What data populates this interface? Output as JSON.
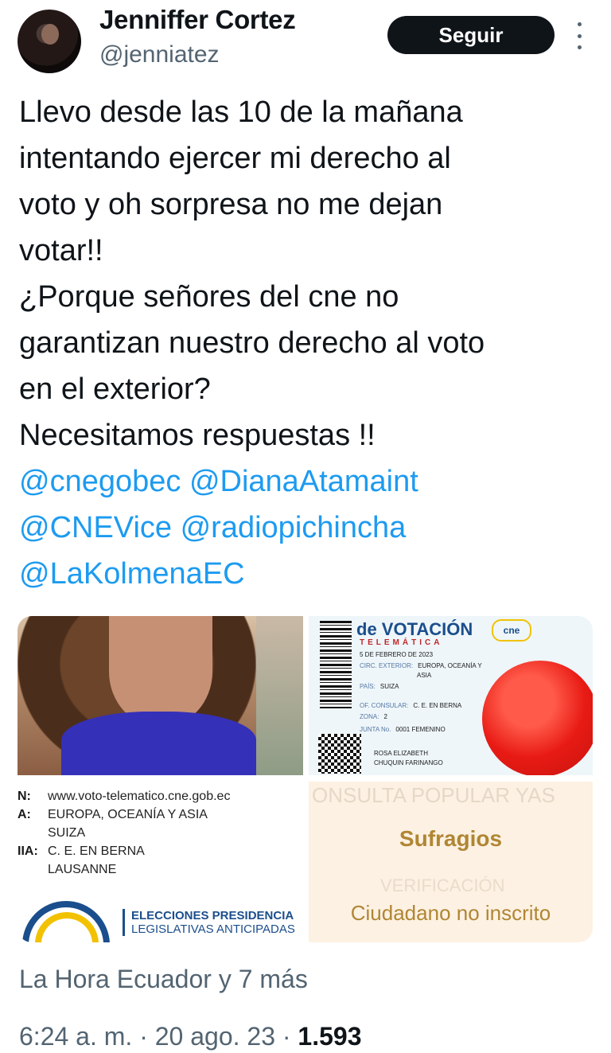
{
  "author": {
    "name": "Jenniffer Cortez",
    "handle": "@jenniatez",
    "follow_label": "Seguir"
  },
  "tweet": {
    "lines": [
      "Llevo desde las 10 de la mañana",
      "intentando ejercer mi derecho al",
      "voto y oh sorpresa no me dejan",
      "votar!!",
      "¿Porque señores del cne no",
      "garantizan nuestro derecho al voto",
      "en el exterior?",
      "Necesitamos respuestas !!"
    ],
    "mentions": [
      "@cnegobec",
      "@DianaAtamaint",
      "@CNEVice",
      "@radiopichincha",
      "@LaKolmenaEC"
    ]
  },
  "media": {
    "certificate": {
      "title": "de VOTACIÓN",
      "subtitle": "TELEMÁTICA",
      "date": "5 DE FEBRERO DE 2023",
      "circ_label": "CIRC. EXTERIOR:",
      "circ_value": "EUROPA, OCEANÍA Y",
      "circ_value2": "ASIA",
      "pais_label": "PAÍS:",
      "pais_value": "SUIZA",
      "consular_label": "OF. CONSULAR:",
      "consular_value": "C. E. EN BERNA",
      "zona_label": "ZONA:",
      "zona_value": "2",
      "junta_label": "JUNTA No.",
      "junta_value": "0001 FEMENINO",
      "signer1": "ROSA ELIZABETH",
      "signer2": "CHUQUIN FARINANGO",
      "logo": "cne"
    },
    "info": {
      "rows": [
        {
          "k": "N:",
          "v": "www.voto-telematico.cne.gob.ec"
        },
        {
          "k": "A:",
          "v": "EUROPA, OCEANÍA Y ASIA"
        },
        {
          "k": "",
          "v": "SUIZA"
        },
        {
          "k": "IIA:",
          "v": "C. E. EN BERNA"
        },
        {
          "k": "",
          "v": "LAUSANNE"
        }
      ],
      "election_line1": "ELECCIONES PRESIDENCIA",
      "election_line2": "LEGISLATIVAS ANTICIPADAS"
    },
    "sufragios": {
      "faint_top": "ONSULTA POPULAR YAS",
      "title": "Sufragios",
      "faint_mid": "VERIFICACIÓN",
      "status": "Ciudadano no inscrito"
    }
  },
  "attribution": "La Hora Ecuador y 7 más",
  "meta": {
    "time": "6:24 a. m.",
    "sep1": " · ",
    "date": "20 ago. 23",
    "sep2": " · ",
    "views": "1.593"
  }
}
